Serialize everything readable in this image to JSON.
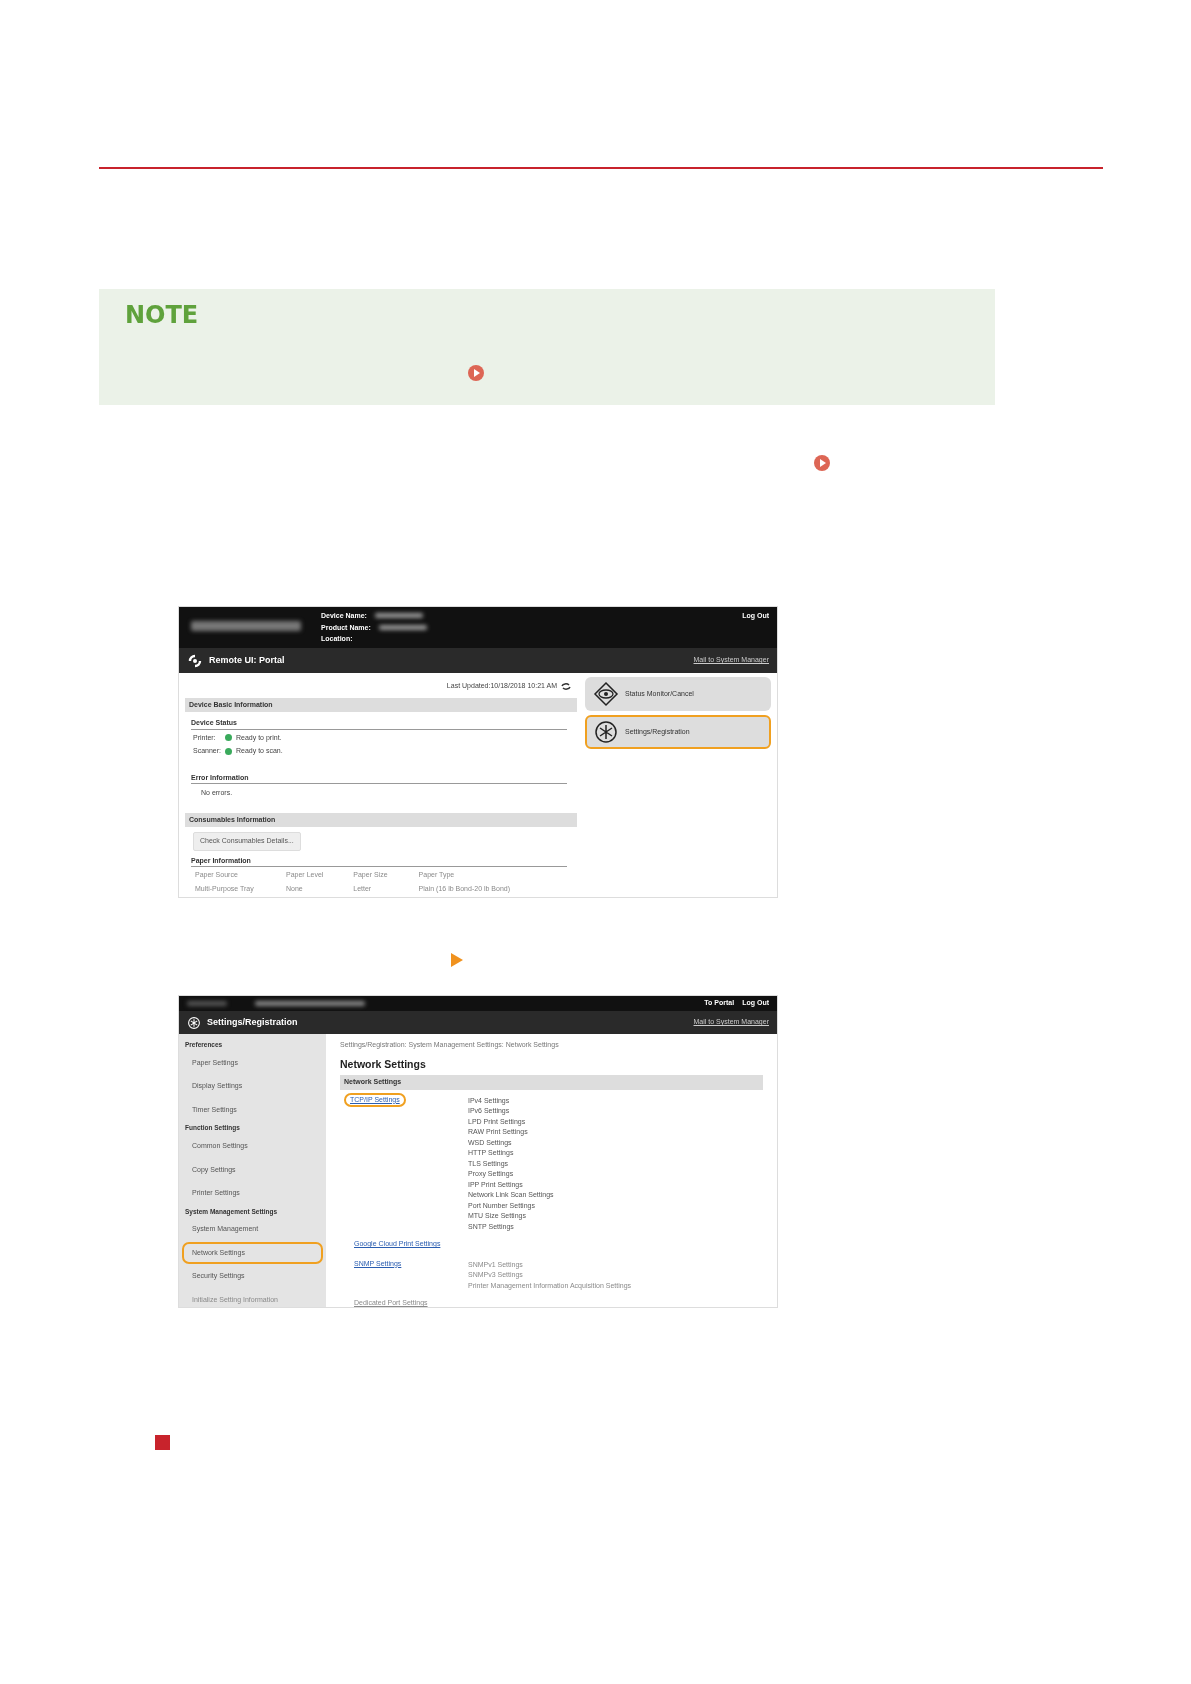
{
  "note": {
    "title": "NOTE"
  },
  "portal": {
    "header": {
      "labels": [
        "Device Name:",
        "Product Name:",
        "Location:"
      ],
      "logout": "Log Out"
    },
    "titlebar": {
      "title": "Remote UI: Portal",
      "mail": "Mail to System Manager"
    },
    "last_updated": "Last Updated:10/18/2018 10:21 AM",
    "device_section": "Device Basic Information",
    "status_heading": "Device Status",
    "statuses": [
      {
        "label": "Printer:",
        "text": "Ready to print.",
        "color": "#3aaa5c"
      },
      {
        "label": "Scanner:",
        "text": "Ready to scan.",
        "color": "#3aaa5c"
      }
    ],
    "error_heading": "Error Information",
    "error_text": "No errors.",
    "consumables_section": "Consumables Information",
    "details_button": "Check Consumables Details...",
    "paper_heading": "Paper Information",
    "paper_columns": [
      "Paper Source",
      "Paper Level",
      "Paper Size",
      "Paper Type"
    ],
    "paper_row": [
      "Multi-Purpose Tray",
      "None",
      "Letter",
      "Plain (16 lb Bond-20 lb Bond)"
    ],
    "menu": [
      {
        "label": "Status Monitor/Cancel",
        "highlighted": false
      },
      {
        "label": "Settings/Registration",
        "highlighted": true
      }
    ]
  },
  "settings": {
    "top_links": [
      "To Portal",
      "Log Out"
    ],
    "titlebar": {
      "title": "Settings/Registration",
      "mail": "Mail to System Manager"
    },
    "sidebar": [
      {
        "heading": "Preferences",
        "items": [
          {
            "label": "Paper Settings",
            "highlighted": false,
            "faded": false
          },
          {
            "label": "Display Settings",
            "highlighted": false,
            "faded": false
          },
          {
            "label": "Timer Settings",
            "highlighted": false,
            "faded": false
          }
        ]
      },
      {
        "heading": "Function Settings",
        "items": [
          {
            "label": "Common Settings",
            "highlighted": false,
            "faded": false
          },
          {
            "label": "Copy Settings",
            "highlighted": false,
            "faded": false
          },
          {
            "label": "Printer Settings",
            "highlighted": false,
            "faded": false
          }
        ]
      },
      {
        "heading": "System Management Settings",
        "items": [
          {
            "label": "System Management",
            "highlighted": false,
            "faded": false
          },
          {
            "label": "Network Settings",
            "highlighted": true,
            "faded": false
          },
          {
            "label": "Security Settings",
            "highlighted": false,
            "faded": false
          },
          {
            "label": "Initialize Setting Information",
            "highlighted": false,
            "faded": true
          }
        ]
      }
    ],
    "breadcrumb": "Settings/Registration: System Management Settings: Network Settings",
    "heading": "Network Settings",
    "section": "Network Settings",
    "groups": [
      {
        "link": "TCP/IP Settings",
        "highlighted": true,
        "faded": false,
        "subitems": [
          "IPv4 Settings",
          "IPv6 Settings",
          "LPD Print Settings",
          "RAW Print Settings",
          "WSD Settings",
          "HTTP Settings",
          "TLS Settings",
          "Proxy Settings",
          "IPP Print Settings",
          "Network Link Scan Settings",
          "Port Number Settings",
          "MTU Size Settings",
          "SNTP Settings"
        ]
      },
      {
        "link": "Google Cloud Print Settings",
        "highlighted": false,
        "faded": false
      },
      {
        "link": "SNMP Settings",
        "highlighted": false,
        "faded": false,
        "subitems": [
          "SNMPv1 Settings",
          "SNMPv3 Settings",
          "Printer Management Information Acquisition Settings"
        ]
      },
      {
        "link": "Dedicated Port Settings",
        "highlighted": false,
        "faded": true
      }
    ]
  }
}
